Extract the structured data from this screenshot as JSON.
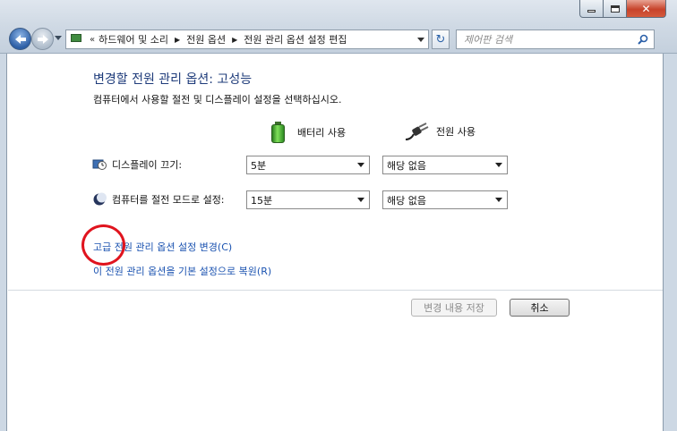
{
  "window": {
    "caption_buttons": {
      "minimize": "minimize-icon",
      "maximize": "maximize-icon",
      "close": "close-icon"
    }
  },
  "nav": {
    "breadcrumb_prefix": "«",
    "breadcrumb": [
      "하드웨어 및 소리",
      "전원 옵션",
      "전원 관리 옵션 설정 편집"
    ],
    "search_placeholder": "제어판 검색"
  },
  "page": {
    "title": "변경할 전원 관리 옵션: 고성능",
    "description": "컴퓨터에서 사용할 절전 및 디스플레이 설정을 선택하십시오.",
    "columns": {
      "battery": "배터리 사용",
      "plugged": "전원 사용"
    },
    "rows": [
      {
        "label": "디스플레이 끄기:",
        "icon": "display-clock-icon",
        "battery_value": "5분",
        "plugged_value": "해당 없음"
      },
      {
        "label": "컴퓨터를 절전 모드로 설정:",
        "icon": "moon-sleep-icon",
        "battery_value": "15분",
        "plugged_value": "해당 없음"
      }
    ],
    "links": {
      "advanced": "고급 전원 관리 옵션 설정 변경(C)",
      "restore": "이 전원 관리 옵션을 기본 설정으로 복원(R)"
    },
    "buttons": {
      "save": "변경 내용 저장",
      "cancel": "취소"
    }
  },
  "colors": {
    "title": "#1e3b7a",
    "link": "#1a52b0",
    "highlight_circle": "#e0141e"
  }
}
